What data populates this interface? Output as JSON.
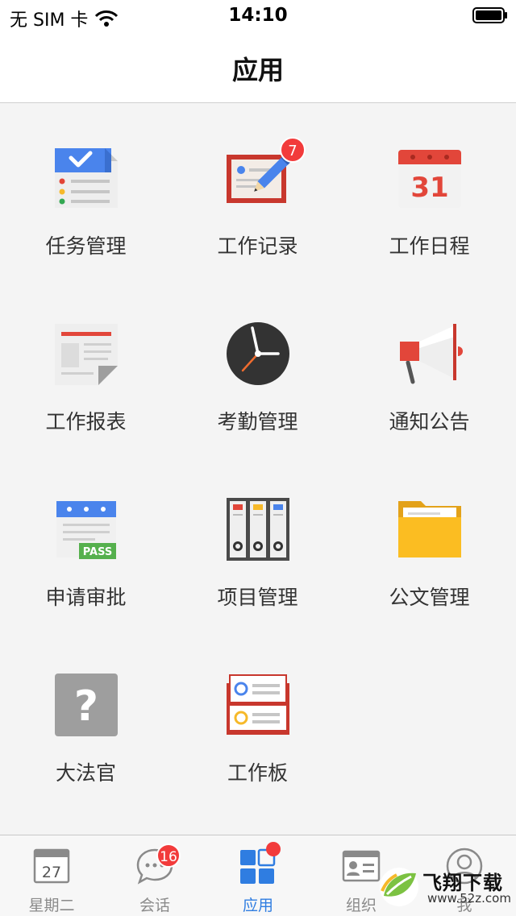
{
  "status_bar": {
    "carrier": "无 SIM 卡",
    "time": "14:10"
  },
  "nav": {
    "title": "应用"
  },
  "apps": [
    {
      "label": "任务管理",
      "icon": "task-list-icon"
    },
    {
      "label": "工作记录",
      "icon": "work-log-icon",
      "badge": "7"
    },
    {
      "label": "工作日程",
      "icon": "calendar-icon",
      "calendar_day": "31"
    },
    {
      "label": "工作报表",
      "icon": "report-icon"
    },
    {
      "label": "考勤管理",
      "icon": "clock-icon"
    },
    {
      "label": "通知公告",
      "icon": "megaphone-icon"
    },
    {
      "label": "申请审批",
      "icon": "approval-icon",
      "stamp": "PASS"
    },
    {
      "label": "项目管理",
      "icon": "binders-icon"
    },
    {
      "label": "公文管理",
      "icon": "folder-icon"
    },
    {
      "label": "大法官",
      "icon": "question-icon",
      "symbol": "?"
    },
    {
      "label": "工作板",
      "icon": "work-board-icon"
    }
  ],
  "tabs": [
    {
      "label": "星期二",
      "icon": "calendar-tab-icon",
      "day": "27"
    },
    {
      "label": "会话",
      "icon": "chat-icon",
      "badge": "16"
    },
    {
      "label": "应用",
      "icon": "apps-grid-icon",
      "active": true
    },
    {
      "label": "组织",
      "icon": "contacts-card-icon"
    },
    {
      "label": "我",
      "icon": "profile-icon"
    }
  ],
  "watermark": {
    "title": "飞翔下载",
    "url": "www.52z.com"
  },
  "colors": {
    "accent": "#2f7de1",
    "badge": "#f23b3b"
  }
}
